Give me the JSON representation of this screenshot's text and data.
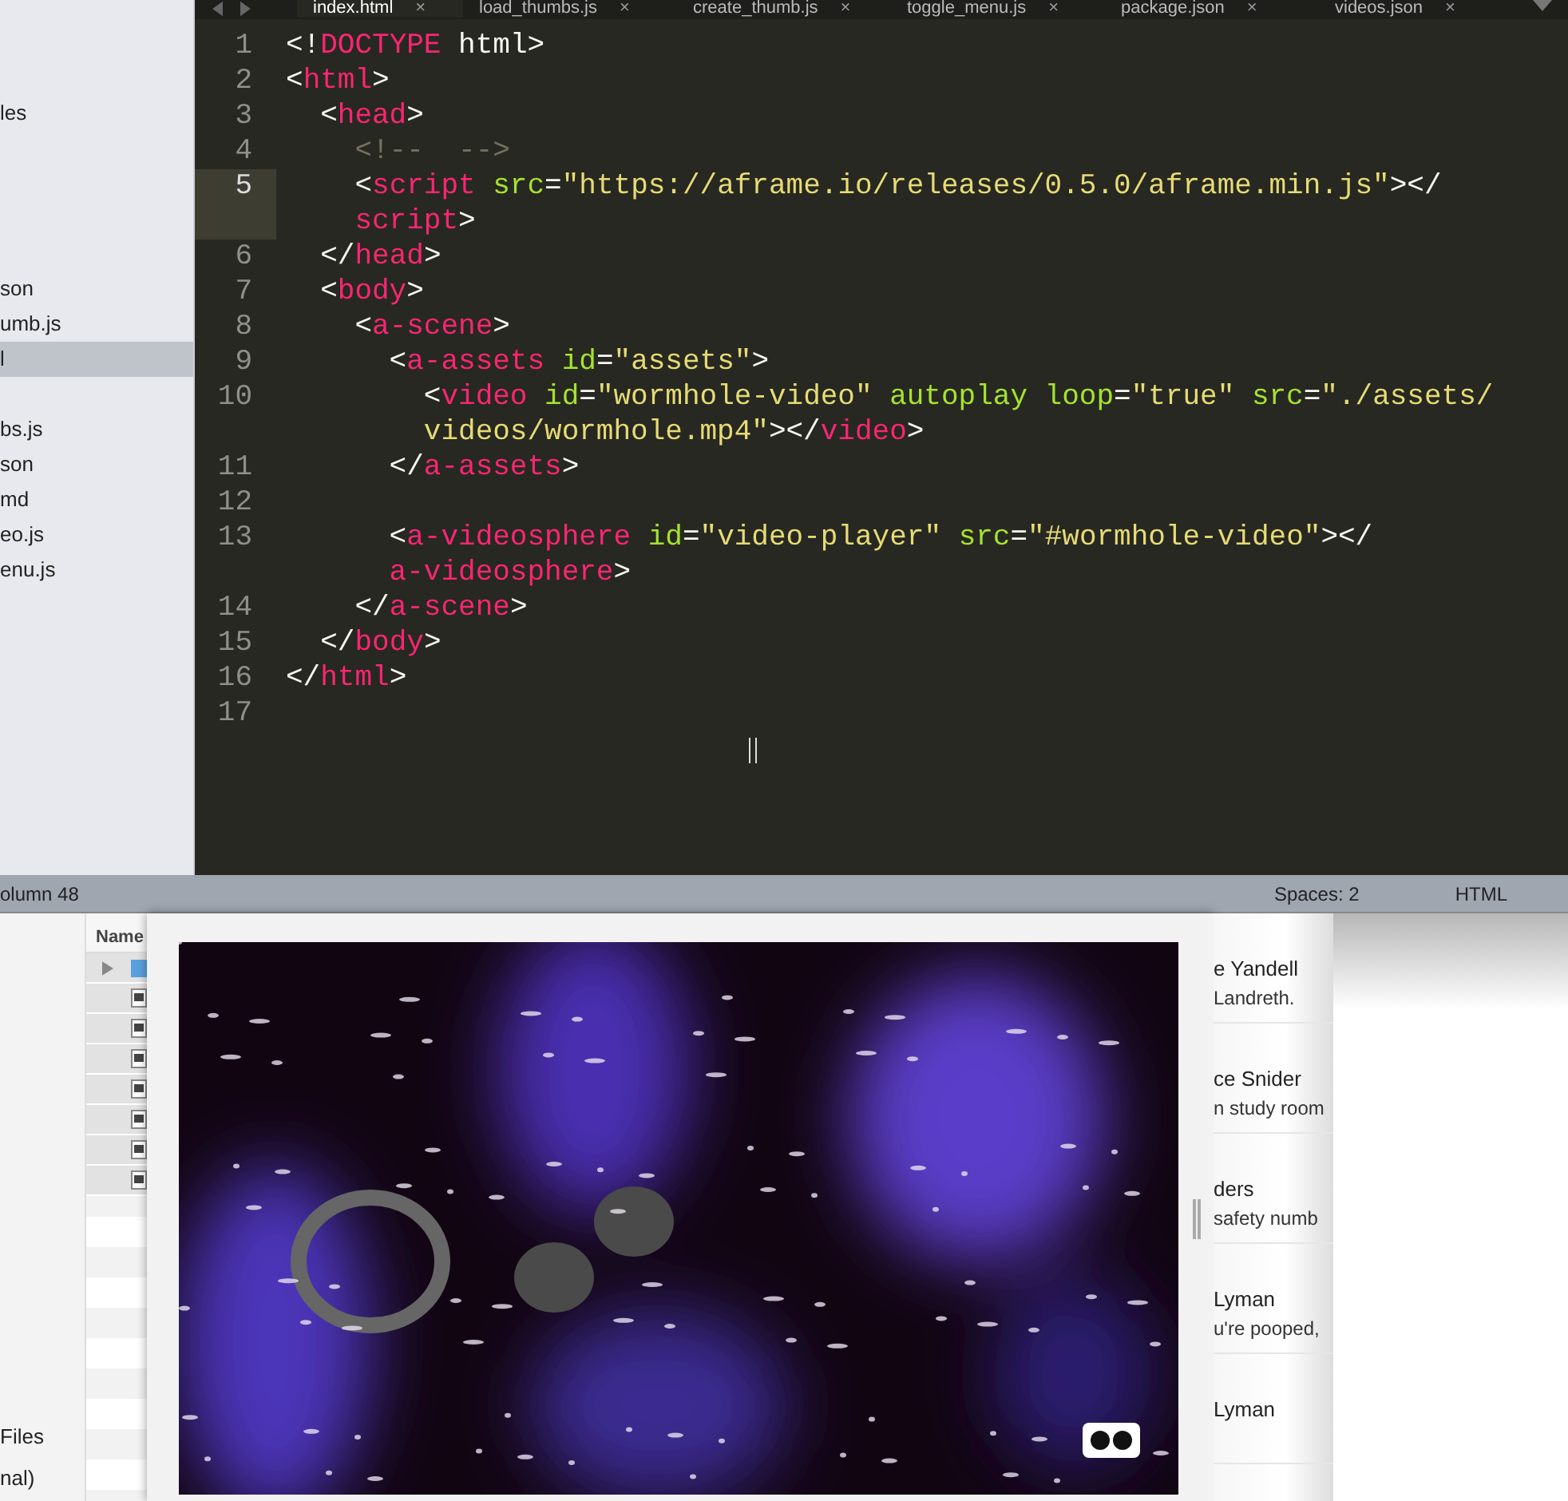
{
  "tabs": [
    {
      "label": "index.html",
      "close": "×",
      "selected": true
    },
    {
      "label": "load_thumbs.js",
      "close": "×",
      "selected": false
    },
    {
      "label": "create_thumb.js",
      "close": "×",
      "selected": false
    },
    {
      "label": "toggle_menu.js",
      "close": "×",
      "selected": false
    },
    {
      "label": "package.json",
      "close": "×",
      "selected": false
    },
    {
      "label": "videos.json",
      "close": "×",
      "selected": false
    }
  ],
  "sidebar": {
    "groups": [
      [
        {
          "label": "les",
          "selected": false
        }
      ],
      [
        {
          "label": "son",
          "selected": false
        },
        {
          "label": "umb.js",
          "selected": false
        },
        {
          "label": "l",
          "selected": true
        }
      ],
      [
        {
          "label": "bs.js",
          "selected": false
        },
        {
          "label": "son",
          "selected": false
        },
        {
          "label": "md",
          "selected": false
        },
        {
          "label": "eo.js",
          "selected": false
        },
        {
          "label": "enu.js",
          "selected": false
        }
      ]
    ]
  },
  "code": [
    {
      "number": "1",
      "current": false,
      "rows": [
        {
          "tokens": [
            {
              "kind": "plain",
              "text": "<!"
            },
            {
              "kind": "tag",
              "text": "DOCTYPE"
            },
            {
              "kind": "plain",
              "text": " html>"
            }
          ]
        }
      ]
    },
    {
      "number": "2",
      "current": false,
      "rows": [
        {
          "tokens": [
            {
              "kind": "plain",
              "text": "<"
            },
            {
              "kind": "tag",
              "text": "html"
            },
            {
              "kind": "plain",
              "text": ">"
            }
          ]
        }
      ]
    },
    {
      "number": "3",
      "current": false,
      "rows": [
        {
          "tokens": [
            {
              "kind": "plain",
              "text": "  <"
            },
            {
              "kind": "tag",
              "text": "head"
            },
            {
              "kind": "plain",
              "text": ">"
            }
          ]
        }
      ]
    },
    {
      "number": "4",
      "current": false,
      "rows": [
        {
          "tokens": [
            {
              "kind": "comment",
              "text": "    <!--  -->"
            }
          ]
        }
      ]
    },
    {
      "number": "5",
      "current": true,
      "rows": [
        {
          "tokens": [
            {
              "kind": "plain",
              "text": "    <"
            },
            {
              "kind": "tag",
              "text": "script"
            },
            {
              "kind": "attr",
              "text": " src"
            },
            {
              "kind": "plain",
              "text": "="
            },
            {
              "kind": "string",
              "text": "\"https://aframe.io/releases/0.5.0/aframe.min.js\""
            },
            {
              "kind": "plain",
              "text": "></"
            }
          ]
        },
        {
          "tokens": [
            {
              "kind": "tag",
              "text": "    script"
            },
            {
              "kind": "plain",
              "text": ">"
            }
          ]
        }
      ]
    },
    {
      "number": "6",
      "current": false,
      "rows": [
        {
          "tokens": [
            {
              "kind": "plain",
              "text": "  </"
            },
            {
              "kind": "tag",
              "text": "head"
            },
            {
              "kind": "plain",
              "text": ">"
            }
          ]
        }
      ]
    },
    {
      "number": "7",
      "current": false,
      "rows": [
        {
          "tokens": [
            {
              "kind": "plain",
              "text": "  <"
            },
            {
              "kind": "tag",
              "text": "body"
            },
            {
              "kind": "plain",
              "text": ">"
            }
          ]
        }
      ]
    },
    {
      "number": "8",
      "current": false,
      "rows": [
        {
          "tokens": [
            {
              "kind": "plain",
              "text": "    <"
            },
            {
              "kind": "tag",
              "text": "a-scene"
            },
            {
              "kind": "plain",
              "text": ">"
            }
          ]
        }
      ]
    },
    {
      "number": "9",
      "current": false,
      "rows": [
        {
          "tokens": [
            {
              "kind": "plain",
              "text": "      <"
            },
            {
              "kind": "tag",
              "text": "a-assets"
            },
            {
              "kind": "attr",
              "text": " id"
            },
            {
              "kind": "plain",
              "text": "="
            },
            {
              "kind": "string",
              "text": "\"assets\""
            },
            {
              "kind": "plain",
              "text": ">"
            }
          ]
        }
      ]
    },
    {
      "number": "10",
      "current": false,
      "rows": [
        {
          "tokens": [
            {
              "kind": "plain",
              "text": "        <"
            },
            {
              "kind": "tag",
              "text": "video"
            },
            {
              "kind": "attr",
              "text": " id"
            },
            {
              "kind": "plain",
              "text": "="
            },
            {
              "kind": "string",
              "text": "\"wormhole-video\""
            },
            {
              "kind": "attr",
              "text": " autoplay loop"
            },
            {
              "kind": "plain",
              "text": "="
            },
            {
              "kind": "string",
              "text": "\"true\""
            },
            {
              "kind": "attr",
              "text": " src"
            },
            {
              "kind": "plain",
              "text": "="
            },
            {
              "kind": "string",
              "text": "\"./assets/"
            }
          ]
        },
        {
          "tokens": [
            {
              "kind": "string",
              "text": "        videos/wormhole.mp4\""
            },
            {
              "kind": "plain",
              "text": "></"
            },
            {
              "kind": "tag",
              "text": "video"
            },
            {
              "kind": "plain",
              "text": ">"
            }
          ]
        }
      ]
    },
    {
      "number": "11",
      "current": false,
      "rows": [
        {
          "tokens": [
            {
              "kind": "plain",
              "text": "      </"
            },
            {
              "kind": "tag",
              "text": "a-assets"
            },
            {
              "kind": "plain",
              "text": ">"
            }
          ]
        }
      ]
    },
    {
      "number": "12",
      "current": false
    },
    {
      "number": "13",
      "current": false,
      "rows": [
        {
          "tokens": [
            {
              "kind": "plain",
              "text": "      <"
            },
            {
              "kind": "tag",
              "text": "a-videosphere"
            },
            {
              "kind": "attr",
              "text": " id"
            },
            {
              "kind": "plain",
              "text": "="
            },
            {
              "kind": "string",
              "text": "\"video-player\""
            },
            {
              "kind": "attr",
              "text": " src"
            },
            {
              "kind": "plain",
              "text": "="
            },
            {
              "kind": "string",
              "text": "\"#wormhole-video\""
            },
            {
              "kind": "plain",
              "text": "></"
            }
          ]
        },
        {
          "tokens": [
            {
              "kind": "tag",
              "text": "      a-videosphere"
            },
            {
              "kind": "plain",
              "text": ">"
            }
          ]
        }
      ]
    },
    {
      "number": "14",
      "current": false,
      "rows": [
        {
          "tokens": [
            {
              "kind": "plain",
              "text": "    </"
            },
            {
              "kind": "tag",
              "text": "a-scene"
            },
            {
              "kind": "plain",
              "text": ">"
            }
          ]
        }
      ]
    },
    {
      "number": "15",
      "current": false,
      "rows": [
        {
          "tokens": [
            {
              "kind": "plain",
              "text": "  </"
            },
            {
              "kind": "tag",
              "text": "body"
            },
            {
              "kind": "plain",
              "text": ">"
            }
          ]
        }
      ]
    },
    {
      "number": "16",
      "current": false,
      "rows": [
        {
          "tokens": [
            {
              "kind": "plain",
              "text": "</"
            },
            {
              "kind": "tag",
              "text": "html"
            },
            {
              "kind": "plain",
              "text": ">"
            }
          ]
        }
      ]
    },
    {
      "number": "17",
      "current": false
    }
  ],
  "status_bar": {
    "position": "olumn 48",
    "indentation": "Spaces: 2",
    "syntax": "HTML"
  },
  "finder": {
    "column_header": "Name",
    "sidebar_items": [
      "Files",
      "nal)"
    ]
  },
  "chat_list": [
    {
      "name": "e Yandell",
      "message": "Landreth."
    },
    {
      "name": "ce Snider",
      "message": "n study room"
    },
    {
      "name": "ders",
      "message": "safety numb"
    },
    {
      "name": "Lyman",
      "message": "u're pooped,"
    },
    {
      "name": "Lyman"
    }
  ]
}
